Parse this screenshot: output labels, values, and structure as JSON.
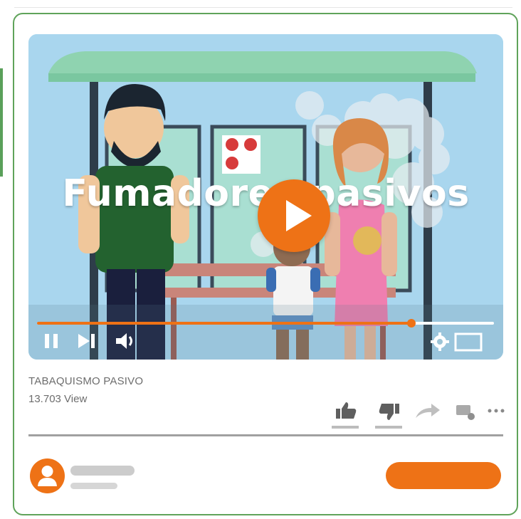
{
  "colors": {
    "accent": "#ee7216",
    "frame": "#5fa35a",
    "text_muted": "#6d6d6d",
    "placeholder": "#cccccc"
  },
  "video": {
    "title_overlay": "Fumadores pasivos",
    "progress_fraction": 0.82
  },
  "controls": {
    "pause_icon": "pause-icon",
    "next_icon": "skip-next-icon",
    "volume_icon": "volume-icon",
    "settings_icon": "gear-icon",
    "fullscreen_icon": "fullscreen-icon"
  },
  "meta": {
    "title": "TABAQUISMO PASIVO",
    "views": "13.703 View"
  },
  "actions": {
    "icons": [
      "thumbs-up-icon",
      "thumbs-down-icon",
      "share-icon",
      "add-to-playlist-icon",
      "more-icon"
    ]
  },
  "channel": {
    "avatar_icon": "user-icon"
  }
}
